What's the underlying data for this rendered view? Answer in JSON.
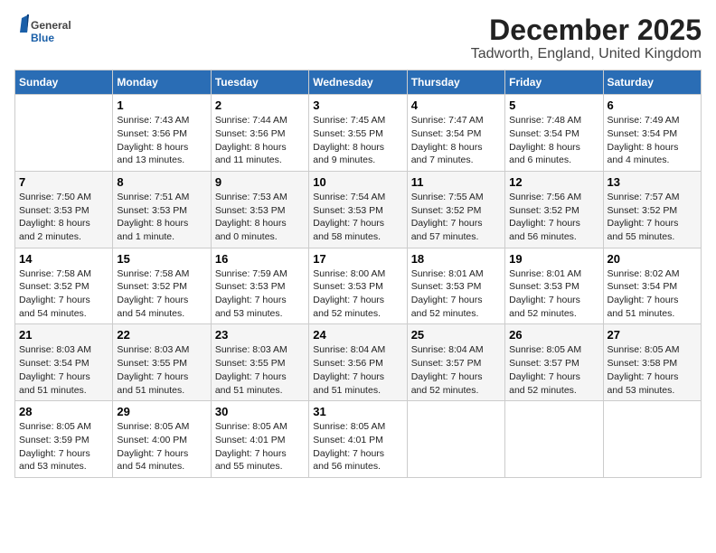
{
  "logo": {
    "general": "General",
    "blue": "Blue"
  },
  "title": "December 2025",
  "subtitle": "Tadworth, England, United Kingdom",
  "days_of_week": [
    "Sunday",
    "Monday",
    "Tuesday",
    "Wednesday",
    "Thursday",
    "Friday",
    "Saturday"
  ],
  "weeks": [
    [
      {
        "day": "",
        "info": ""
      },
      {
        "day": "1",
        "info": "Sunrise: 7:43 AM\nSunset: 3:56 PM\nDaylight: 8 hours\nand 13 minutes."
      },
      {
        "day": "2",
        "info": "Sunrise: 7:44 AM\nSunset: 3:56 PM\nDaylight: 8 hours\nand 11 minutes."
      },
      {
        "day": "3",
        "info": "Sunrise: 7:45 AM\nSunset: 3:55 PM\nDaylight: 8 hours\nand 9 minutes."
      },
      {
        "day": "4",
        "info": "Sunrise: 7:47 AM\nSunset: 3:54 PM\nDaylight: 8 hours\nand 7 minutes."
      },
      {
        "day": "5",
        "info": "Sunrise: 7:48 AM\nSunset: 3:54 PM\nDaylight: 8 hours\nand 6 minutes."
      },
      {
        "day": "6",
        "info": "Sunrise: 7:49 AM\nSunset: 3:54 PM\nDaylight: 8 hours\nand 4 minutes."
      }
    ],
    [
      {
        "day": "7",
        "info": "Sunrise: 7:50 AM\nSunset: 3:53 PM\nDaylight: 8 hours\nand 2 minutes."
      },
      {
        "day": "8",
        "info": "Sunrise: 7:51 AM\nSunset: 3:53 PM\nDaylight: 8 hours\nand 1 minute."
      },
      {
        "day": "9",
        "info": "Sunrise: 7:53 AM\nSunset: 3:53 PM\nDaylight: 8 hours\nand 0 minutes."
      },
      {
        "day": "10",
        "info": "Sunrise: 7:54 AM\nSunset: 3:53 PM\nDaylight: 7 hours\nand 58 minutes."
      },
      {
        "day": "11",
        "info": "Sunrise: 7:55 AM\nSunset: 3:52 PM\nDaylight: 7 hours\nand 57 minutes."
      },
      {
        "day": "12",
        "info": "Sunrise: 7:56 AM\nSunset: 3:52 PM\nDaylight: 7 hours\nand 56 minutes."
      },
      {
        "day": "13",
        "info": "Sunrise: 7:57 AM\nSunset: 3:52 PM\nDaylight: 7 hours\nand 55 minutes."
      }
    ],
    [
      {
        "day": "14",
        "info": "Sunrise: 7:58 AM\nSunset: 3:52 PM\nDaylight: 7 hours\nand 54 minutes."
      },
      {
        "day": "15",
        "info": "Sunrise: 7:58 AM\nSunset: 3:52 PM\nDaylight: 7 hours\nand 54 minutes."
      },
      {
        "day": "16",
        "info": "Sunrise: 7:59 AM\nSunset: 3:53 PM\nDaylight: 7 hours\nand 53 minutes."
      },
      {
        "day": "17",
        "info": "Sunrise: 8:00 AM\nSunset: 3:53 PM\nDaylight: 7 hours\nand 52 minutes."
      },
      {
        "day": "18",
        "info": "Sunrise: 8:01 AM\nSunset: 3:53 PM\nDaylight: 7 hours\nand 52 minutes."
      },
      {
        "day": "19",
        "info": "Sunrise: 8:01 AM\nSunset: 3:53 PM\nDaylight: 7 hours\nand 52 minutes."
      },
      {
        "day": "20",
        "info": "Sunrise: 8:02 AM\nSunset: 3:54 PM\nDaylight: 7 hours\nand 51 minutes."
      }
    ],
    [
      {
        "day": "21",
        "info": "Sunrise: 8:03 AM\nSunset: 3:54 PM\nDaylight: 7 hours\nand 51 minutes."
      },
      {
        "day": "22",
        "info": "Sunrise: 8:03 AM\nSunset: 3:55 PM\nDaylight: 7 hours\nand 51 minutes."
      },
      {
        "day": "23",
        "info": "Sunrise: 8:03 AM\nSunset: 3:55 PM\nDaylight: 7 hours\nand 51 minutes."
      },
      {
        "day": "24",
        "info": "Sunrise: 8:04 AM\nSunset: 3:56 PM\nDaylight: 7 hours\nand 51 minutes."
      },
      {
        "day": "25",
        "info": "Sunrise: 8:04 AM\nSunset: 3:57 PM\nDaylight: 7 hours\nand 52 minutes."
      },
      {
        "day": "26",
        "info": "Sunrise: 8:05 AM\nSunset: 3:57 PM\nDaylight: 7 hours\nand 52 minutes."
      },
      {
        "day": "27",
        "info": "Sunrise: 8:05 AM\nSunset: 3:58 PM\nDaylight: 7 hours\nand 53 minutes."
      }
    ],
    [
      {
        "day": "28",
        "info": "Sunrise: 8:05 AM\nSunset: 3:59 PM\nDaylight: 7 hours\nand 53 minutes."
      },
      {
        "day": "29",
        "info": "Sunrise: 8:05 AM\nSunset: 4:00 PM\nDaylight: 7 hours\nand 54 minutes."
      },
      {
        "day": "30",
        "info": "Sunrise: 8:05 AM\nSunset: 4:01 PM\nDaylight: 7 hours\nand 55 minutes."
      },
      {
        "day": "31",
        "info": "Sunrise: 8:05 AM\nSunset: 4:01 PM\nDaylight: 7 hours\nand 56 minutes."
      },
      {
        "day": "",
        "info": ""
      },
      {
        "day": "",
        "info": ""
      },
      {
        "day": "",
        "info": ""
      }
    ]
  ]
}
